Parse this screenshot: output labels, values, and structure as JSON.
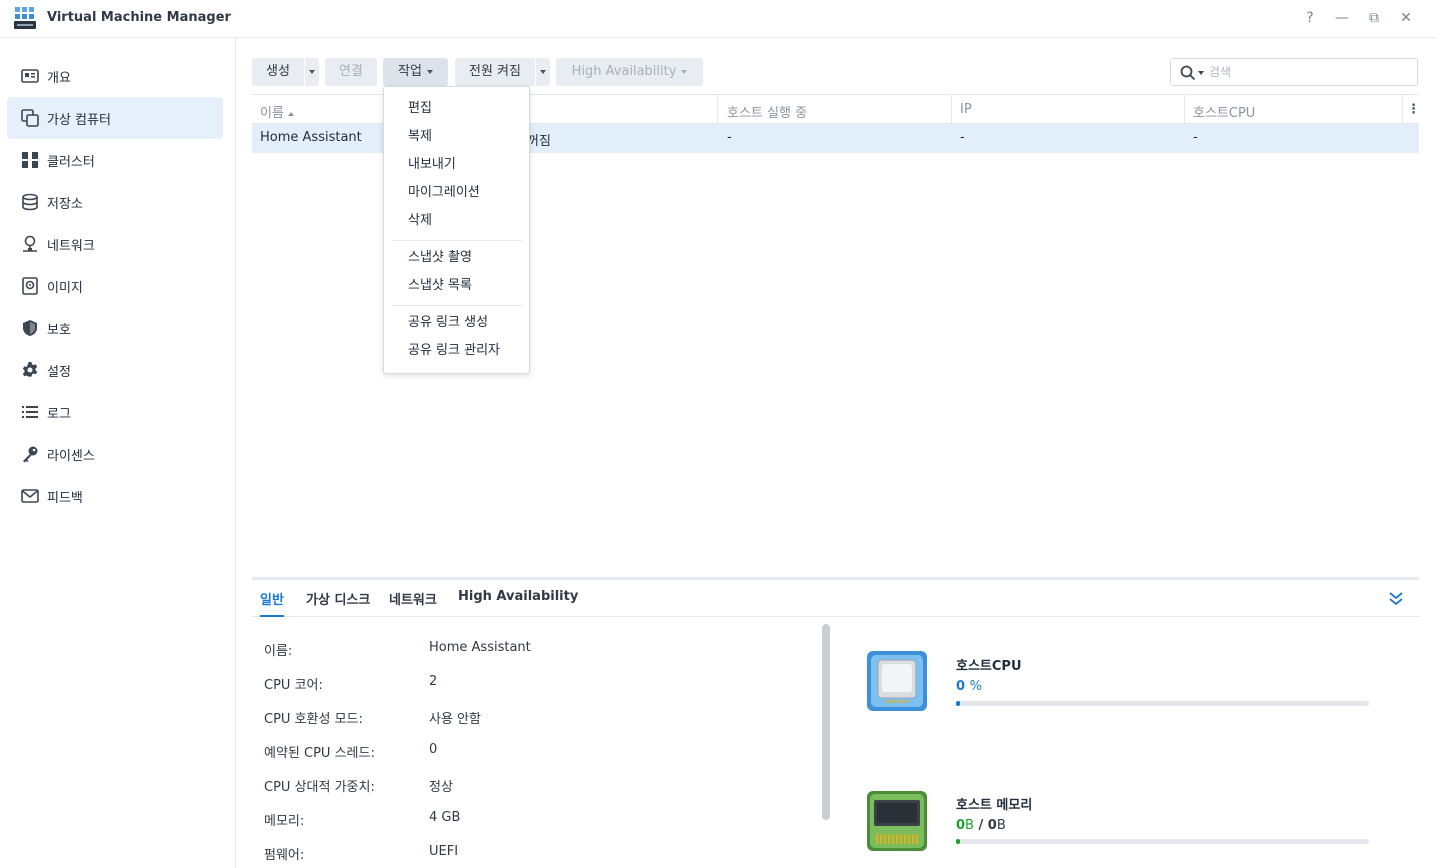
{
  "window": {
    "title": "Virtual Machine Manager",
    "help": "?",
    "minimize": "—",
    "restore": "⧉",
    "close": "✕"
  },
  "sidebar": {
    "items": [
      {
        "label": "개요",
        "icon": "overview-icon"
      },
      {
        "label": "가상 컴퓨터",
        "icon": "virtual-machine-icon"
      },
      {
        "label": "클러스터",
        "icon": "cluster-icon"
      },
      {
        "label": "저장소",
        "icon": "storage-icon"
      },
      {
        "label": "네트워크",
        "icon": "network-icon"
      },
      {
        "label": "이미지",
        "icon": "image-icon"
      },
      {
        "label": "보호",
        "icon": "shield-icon"
      },
      {
        "label": "설정",
        "icon": "gear-icon"
      },
      {
        "label": "로그",
        "icon": "log-icon"
      },
      {
        "label": "라이센스",
        "icon": "key-icon"
      },
      {
        "label": "피드백",
        "icon": "mail-icon"
      }
    ],
    "active": "가상 컴퓨터"
  },
  "toolbar": {
    "create": "생성",
    "connect": "연결",
    "action": "작업",
    "power_on": "전원 켜짐",
    "high_availability": "High Availability",
    "search_placeholder": "검색"
  },
  "grid": {
    "columns": [
      "이름",
      "호스트 실행 중",
      "IP",
      "호스트CPU"
    ],
    "rows": [
      {
        "name": "Home Assistant",
        "status": "꺼짐",
        "host": "-",
        "ip": "-",
        "cpu": "-"
      }
    ]
  },
  "action_menu": {
    "group1": [
      "편집",
      "복제",
      "내보내기",
      "마이그레이션",
      "삭제"
    ],
    "group2": [
      "스냅샷 촬영",
      "스냅샷 목록"
    ],
    "group3": [
      "공유 링크 생성",
      "공유 링크 관리자"
    ]
  },
  "detail": {
    "tabs": [
      "일반",
      "가상 디스크",
      "네트워크",
      "High Availability"
    ],
    "active_tab": "일반",
    "props": [
      {
        "label": "이름:",
        "value": "Home Assistant"
      },
      {
        "label": "CPU 코어:",
        "value": "2"
      },
      {
        "label": "CPU 호환성 모드:",
        "value": "사용 안함"
      },
      {
        "label": "예약된 CPU 스레드:",
        "value": "0"
      },
      {
        "label": "CPU 상대적 가중치:",
        "value": "정상"
      },
      {
        "label": "메모리:",
        "value": "4 GB"
      },
      {
        "label": "펌웨어:",
        "value": "UEFI"
      }
    ],
    "cpu": {
      "title": "호스트CPU",
      "value": "0",
      "unit": "%",
      "fraction": 0.01,
      "color": "#1b78d0"
    },
    "memory": {
      "title": "호스트 메모리",
      "used": "0",
      "used_unit": "B",
      "sep": "/",
      "total": "0",
      "total_unit": "B",
      "fraction": 0.01,
      "color": "#1aa32a"
    }
  }
}
